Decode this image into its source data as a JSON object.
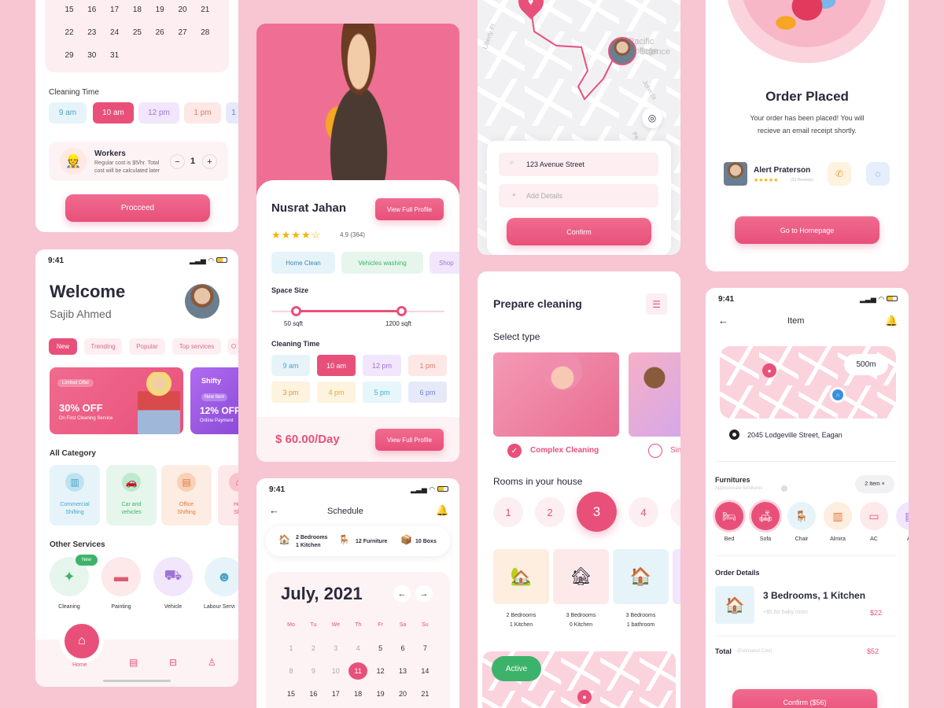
{
  "colors": {
    "accent": "#e8507a",
    "bg": "#f7c6d2"
  },
  "booking": {
    "cal_rows": [
      [
        "15",
        "16",
        "17",
        "18",
        "19",
        "20",
        "21"
      ],
      [
        "22",
        "23",
        "24",
        "25",
        "26",
        "27",
        "28"
      ],
      [
        "29",
        "30",
        "31"
      ]
    ],
    "cleaning_time_label": "Cleaning Time",
    "times": [
      "9 am",
      "10 am",
      "12 pm",
      "1 pm",
      "1"
    ],
    "selected_time": "10 am",
    "workers_title": "Workers",
    "workers_desc": "Regular cost is $5/hr. Total cost will be calculated later",
    "workers_count": "1",
    "minus": "−",
    "plus": "+",
    "proceed": "Procceed"
  },
  "home": {
    "time": "9:41",
    "welcome": "Welcome",
    "user": "Sajib Ahmed",
    "filters": [
      "New",
      "Trending",
      "Popular",
      "Top services",
      "O"
    ],
    "promo1": {
      "tag": "Limited Offer",
      "title": "30% OFF",
      "sub": "On First Cleaning Service"
    },
    "promo2": {
      "brand": "Shifty",
      "tag": "New Item",
      "title": "12% OFF",
      "sub": "Online Payment"
    },
    "all_category": "All Category",
    "categories": [
      [
        "Commercial",
        "Shifting"
      ],
      [
        "Car and",
        "vehicles"
      ],
      [
        "Office",
        "Shifting"
      ],
      [
        "Ho",
        "Sh"
      ]
    ],
    "other_services": "Other Services",
    "new_badge": "New",
    "services": [
      "Cleaning",
      "Painting",
      "Vehicle",
      "Labour Servi"
    ],
    "nav_home": "Home"
  },
  "profile": {
    "name": "Nusrat Jahan",
    "view_profile": "View Full Profile",
    "rating": "4.9 (364)",
    "tags": [
      "Home Clean",
      "Vehicles washing",
      "Shop"
    ],
    "space_size": "Space Size",
    "min_size": "50 sqft",
    "max_size": "1200 sqft",
    "cleaning_time": "Cleaning Time",
    "times": [
      "9 am",
      "10 am",
      "12 pm",
      "1 pm",
      "3 pm",
      "4 pm",
      "5 pm",
      "6 pm"
    ],
    "price": "$ 60.00/Day",
    "view_profile2": "View Full Profile"
  },
  "schedule": {
    "time": "9:41",
    "title": "Schedule",
    "summary": [
      [
        "2 Bedrooms",
        "1 Kitchen"
      ],
      [
        "12 Furniture"
      ],
      [
        "10 Boxs"
      ]
    ],
    "month": "July, 2021",
    "weekdays": [
      "Mo",
      "Tu",
      "We",
      "Th",
      "Fr",
      "Sa",
      "Su"
    ],
    "rows": [
      [
        "1",
        "2",
        "3",
        "4",
        "5",
        "6",
        "7"
      ],
      [
        "8",
        "9",
        "10",
        "11",
        "12",
        "13",
        "14"
      ],
      [
        "15",
        "16",
        "17",
        "18",
        "19",
        "20",
        "21"
      ]
    ],
    "selected": "11"
  },
  "tracking": {
    "streets": [
      "Pacific College",
      "Science",
      "Liberty Pl",
      "John St",
      "Pe"
    ],
    "address": "123  Avenue Street",
    "details_placeholder": "Add Details",
    "confirm": "Confirm"
  },
  "prepare": {
    "title": "Prepare cleaning",
    "select_type": "Select type",
    "types": [
      "Complex Cleaning",
      "Sim"
    ],
    "rooms_label": "Rooms in your house",
    "rooms": [
      "1",
      "2",
      "3",
      "4",
      "5"
    ],
    "selected_room": "3",
    "houses": [
      [
        "2 Bedrooms",
        "1 Kitchen"
      ],
      [
        "3 Bedrooms",
        "0 Kitchen"
      ],
      [
        "3 Bedrooms",
        "1 bathroom"
      ]
    ],
    "active": "Active"
  },
  "order": {
    "title": "Order Placed",
    "message": "Your order has been placed! You will recieve an email receipt shortly.",
    "agent": "Alert Praterson",
    "reviews": "(32 Reviews)",
    "go_home": "Go to Homepage"
  },
  "item": {
    "time": "9:41",
    "title": "Item",
    "distance": "500m",
    "address": "2045  Lodgeville Street, Eagan",
    "furnitures": "Furnitures",
    "furnitures_sub": "Approximate furnitures",
    "count": "2 Item",
    "count_x": "×",
    "furniture_items": [
      "Bed",
      "Sofa",
      "Chair",
      "Almira",
      "AC",
      "Ac"
    ],
    "order_details": "Order Details",
    "line_title": "3 Bedrooms, 1 Kitchen",
    "line_sub": "+$5 for baby room",
    "line_price": "$22",
    "total": "Total",
    "total_sub": "(Estimated Cost)",
    "total_price": "$52",
    "confirm": "Confirm ($56)"
  }
}
